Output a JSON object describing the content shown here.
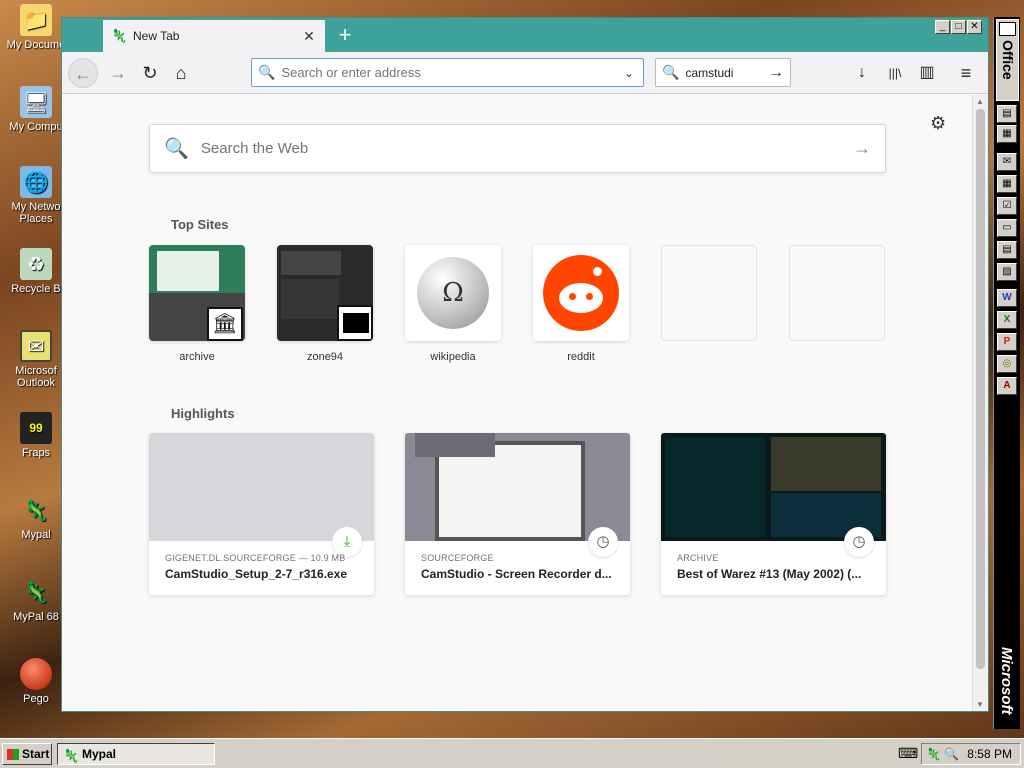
{
  "desktop": {
    "icons": [
      {
        "label": "My Docume",
        "glyph": "📁"
      },
      {
        "label": "My Compu",
        "glyph": "🖥"
      },
      {
        "label": "My Netwo",
        "label2": "Places",
        "glyph": "🌐"
      },
      {
        "label": "Recycle B",
        "glyph": "♻"
      },
      {
        "label": "Microsof",
        "label2": "Outlook",
        "glyph": "✉"
      },
      {
        "label": "Fraps",
        "glyph": "99"
      },
      {
        "label": "Mypal",
        "glyph": "🦎"
      },
      {
        "label": "MyPal 68",
        "glyph": "🦎"
      },
      {
        "label": "Pego",
        "glyph": "●"
      }
    ]
  },
  "browser": {
    "tab_title": "New Tab",
    "tab_close": "✕",
    "new_tab": "+",
    "window_buttons": [
      "_",
      "□",
      "✕"
    ],
    "nav": {
      "back": "←",
      "forward": "→",
      "reload": "↻",
      "home": "⌂"
    },
    "url": {
      "placeholder": "Search or enter address",
      "value": ""
    },
    "search_box": {
      "value": "camstudi"
    },
    "toolbar_right": {
      "downloads": "↓",
      "library": "|||\\",
      "sidebar": "▥",
      "menu": "≡"
    }
  },
  "newtab": {
    "web_search_placeholder": "Search the Web",
    "top_sites_title": "Top Sites",
    "top_sites": [
      {
        "name": "archive"
      },
      {
        "name": "zone94"
      },
      {
        "name": "wikipedia"
      },
      {
        "name": "reddit"
      },
      {
        "name": ""
      },
      {
        "name": ""
      }
    ],
    "highlights_title": "Highlights",
    "highlights": [
      {
        "source": "GIGENET.DL.SOURCEFORGE — 10.9 MB",
        "title": "CamStudio_Setup_2-7_r316.exe",
        "badge": "download"
      },
      {
        "source": "SOURCEFORGE",
        "title": "CamStudio - Screen Recorder d...",
        "badge": "clock"
      },
      {
        "source": "ARCHIVE",
        "title": "Best of Warez #13 (May 2002) (...",
        "badge": "clock"
      }
    ]
  },
  "officebar": {
    "title": "Office",
    "brand": "Microsoft",
    "buttons": [
      "▤",
      "▦",
      "✉",
      "▦",
      "☑",
      "▭",
      "▤",
      "▨",
      "W",
      "X",
      "P",
      "◎",
      "A"
    ]
  },
  "taskbar": {
    "start_label": "Start",
    "task_label": "Mypal",
    "clock": "8:58 PM"
  },
  "colors": {
    "titlebar": "#3ea29a",
    "reddit": "#ff4500",
    "download_green": "#12bc00"
  }
}
